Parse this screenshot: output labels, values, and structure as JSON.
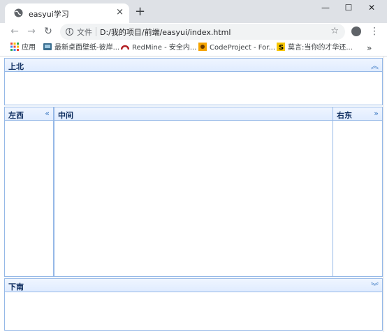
{
  "browser": {
    "tab_title": "easyui学习",
    "tab_close": "×",
    "new_tab": "+",
    "window_controls": {
      "minimize": "—",
      "maximize": "☐",
      "close": "✕"
    },
    "nav": {
      "back": "←",
      "forward": "→",
      "reload": "↻"
    },
    "address": {
      "info": "i",
      "scheme_label": "文件",
      "url": "D:/我的项目/前端/easyui/index.html",
      "star": "☆"
    },
    "menu": "⋮",
    "bookmarks": [
      {
        "label": "应用",
        "icon": "apps-grid-icon"
      },
      {
        "label": "最新桌面壁纸-彼岸...",
        "icon": "site-icon"
      },
      {
        "label": "RedMine - 安全内...",
        "icon": "redmine-icon"
      },
      {
        "label": "CodeProject - For...",
        "icon": "codeproject-icon"
      },
      {
        "label": "莫言:当你的才华还...",
        "icon": "s-icon"
      }
    ],
    "bookmarks_overflow": "»"
  },
  "layout": {
    "north": {
      "title": "上北",
      "tool": "︽"
    },
    "west": {
      "title": "左西",
      "tool": "«"
    },
    "center": {
      "title": "中间"
    },
    "east": {
      "title": "右东",
      "tool": "»"
    },
    "south": {
      "title": "下南",
      "tool": "︾"
    }
  },
  "colors": {
    "panel_border": "#95b8e7",
    "panel_header": "#e0ecff",
    "title_text": "#0e2d5f",
    "tool_icon": "#3a77c2"
  }
}
